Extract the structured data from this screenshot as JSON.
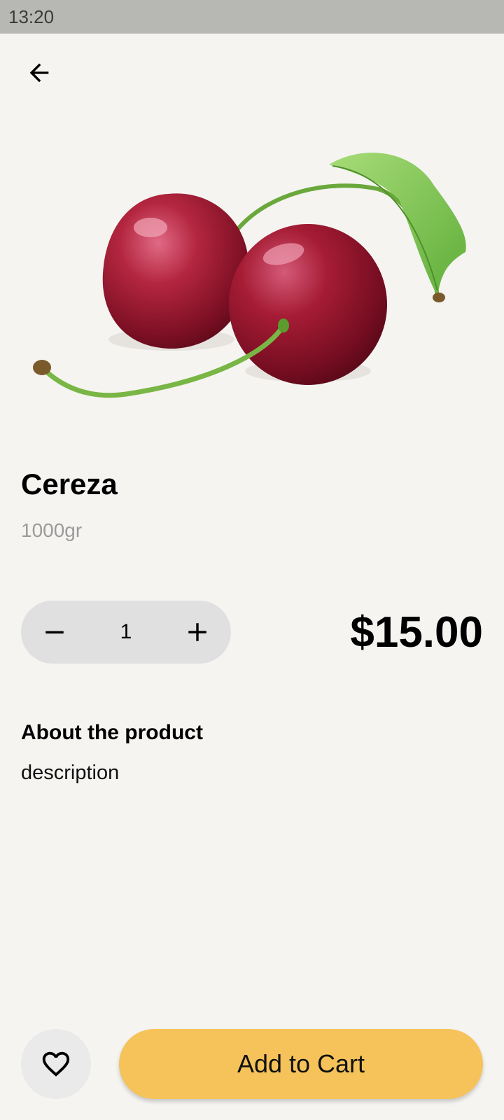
{
  "status_bar": {
    "time": "13:20"
  },
  "navigation": {
    "back_icon": "arrow-left-icon"
  },
  "product": {
    "image_icon": "cherries-image",
    "name": "Cereza",
    "weight": "1000gr",
    "price": "$15.00",
    "quantity": "1"
  },
  "stepper": {
    "minus_icon": "minus-icon",
    "plus_icon": "plus-icon"
  },
  "about": {
    "title": "About the product",
    "description": "description"
  },
  "footer": {
    "favorite_icon": "heart-outline-icon",
    "add_to_cart_label": "Add to Cart",
    "accent_color": "#f5c35a"
  }
}
